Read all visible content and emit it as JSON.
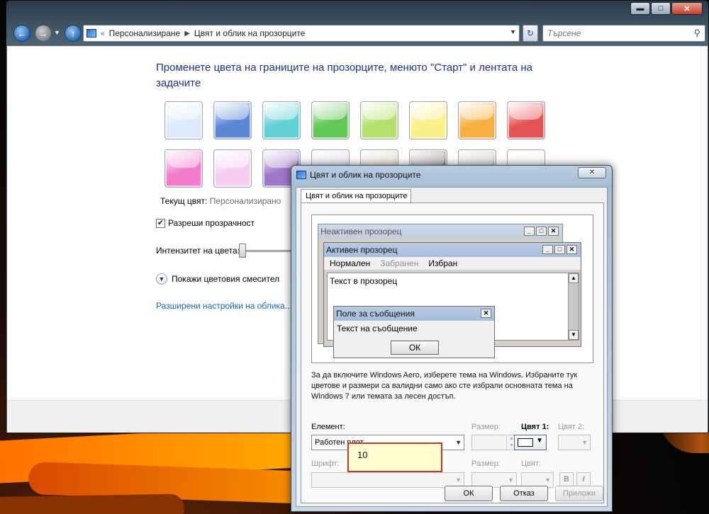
{
  "explorer": {
    "breadcrumb": [
      "Персонализиране",
      "Цвят и облик на прозорците"
    ],
    "search_placeholder": "Търсене",
    "caption": {
      "minimize": "▬",
      "maximize": "□",
      "close": "✕"
    }
  },
  "personalize": {
    "title": "Променете цвета на границите на прозорците, менюто \"Старт\" и лентата на задачите",
    "swatches": [
      "#dceafa",
      "#5b87d6",
      "#63d0d6",
      "#63c758",
      "#b5e06c",
      "#fbef8a",
      "#f7b040",
      "#e55454",
      "#f27ccb",
      "#f6cdf0",
      "#9e77c8",
      "#ddd3e7",
      "#d7cdbd",
      "#8a7c7c",
      "#bdbdbd",
      "#f3f3f3"
    ],
    "current_label": "Текущ цвят:",
    "current_value": "Персонализирано",
    "transparency_label": "Разреши прозрачност",
    "transparency_checked": "✔",
    "intensity_label": "Интензитет на цвета:",
    "intensity_value": 0.02,
    "mixer_label": "Покажи цветовия смесител",
    "advanced_link": "Разширени настройки на облика..."
  },
  "dialog": {
    "title": "Цвят и облик на прозорците",
    "tab": "Цвят и облик на прозорците",
    "preview": {
      "inactive_title": "Неактивен прозорец",
      "active_title": "Активен прозорец",
      "menu_normal": "Нормален",
      "menu_disabled": "Забранен",
      "menu_selected": "Избран",
      "window_text": "Текст в прозорец",
      "msg_title": "Поле за съобщения",
      "msg_text": "Текст на съобщение",
      "ok": "ОК"
    },
    "info": "За да включите Windows Aero, изберете тема на Windows. Избраните тук цветове и размери са валидни само ако сте избрали основната тема на Windows 7 или темата за лесен достъп.",
    "element_label": "Елемент:",
    "element_value": "Работен плот",
    "size_label": "Размер:",
    "color1_label": "Цвят 1:",
    "color2_label": "Цвят 2:",
    "font_label": "Шрифт:",
    "font_size_label": "Размер:",
    "font_color_label": "Цвят:",
    "bold": "B",
    "italic": "I",
    "ok": "ОК",
    "cancel": "Отказ",
    "apply": "Приложи"
  },
  "annotation": {
    "text": "10"
  }
}
